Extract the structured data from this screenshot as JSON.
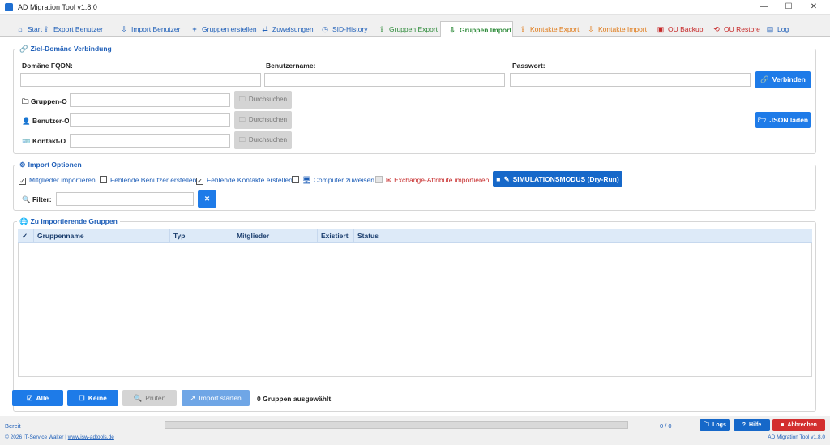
{
  "window": {
    "title": "AD Migration Tool v1.8.0",
    "minimize": "—",
    "maximize": "☐",
    "close": "✕"
  },
  "tabs": [
    {
      "label": "Start",
      "icon": "home-icon",
      "color": "#1f5fb8"
    },
    {
      "label": "Export Benutzer",
      "icon": "export-user-icon",
      "color": "#1f5fb8"
    },
    {
      "label": "Import Benutzer",
      "icon": "import-user-icon",
      "color": "#1f5fb8"
    },
    {
      "label": "Gruppen erstellen",
      "icon": "plus-icon",
      "color": "#1f5fb8"
    },
    {
      "label": "Zuweisungen",
      "icon": "assign-icon",
      "color": "#1f5fb8"
    },
    {
      "label": "SID-History",
      "icon": "history-icon",
      "color": "#1f5fb8"
    },
    {
      "label": "Gruppen Export",
      "icon": "group-export-icon",
      "color": "#2e8b3a"
    },
    {
      "label": "Gruppen Import",
      "icon": "group-import-icon",
      "color": "#2e8b3a"
    },
    {
      "label": "Kontakte Export",
      "icon": "contacts-export-icon",
      "color": "#e07b1a"
    },
    {
      "label": "Kontakte Import",
      "icon": "contacts-import-icon",
      "color": "#e07b1a"
    },
    {
      "label": "OU Backup",
      "icon": "backup-icon",
      "color": "#c62828"
    },
    {
      "label": "OU Restore",
      "icon": "restore-icon",
      "color": "#c62828"
    },
    {
      "label": "Log",
      "icon": "log-icon",
      "color": "#1f5fb8"
    }
  ],
  "connection": {
    "title": "Ziel-Domäne Verbindung",
    "fqdn_label": "Domäne FQDN:",
    "fqdn_value": "",
    "user_label": "Benutzername:",
    "user_value": "",
    "password_label": "Passwort:",
    "password_value": "",
    "connect_button": "Verbinden",
    "groups_ou_label": "Gruppen-O",
    "users_ou_label": "Benutzer-O",
    "contacts_ou_label": "Kontakt-O",
    "browse_label": "Durchsuchen",
    "json_button": "JSON laden"
  },
  "options": {
    "title": "Import Optionen",
    "items": [
      {
        "label": "Mitglieder importieren",
        "checked": true,
        "color": "#1f5fb8"
      },
      {
        "label": "Fehlende Benutzer erstellen",
        "checked": false,
        "color": "#1f5fb8"
      },
      {
        "label": "Fehlende Kontakte erstellen",
        "checked": true,
        "color": "#1f5fb8"
      },
      {
        "label": "Computer zuweisen",
        "checked": false,
        "color": "#1f5fb8"
      },
      {
        "label": "Exchange-Attribute importieren",
        "checked": false,
        "disabled": true,
        "color": "#c62828"
      }
    ],
    "simulation_button": "SIMULATIONSMODUS (Dry-Run)",
    "filter_label": "Filter:",
    "filter_value": "",
    "clear_filter": "✕"
  },
  "groups": {
    "title": "Zu importierende Gruppen",
    "columns": [
      "✓",
      "Gruppenname",
      "Typ",
      "Mitglieder",
      "Existiert",
      "Status"
    ],
    "rows": []
  },
  "actions": {
    "all_button": "Alle",
    "none_button": "Keine",
    "check_button": "Prüfen",
    "start_button": "Import starten",
    "selection_status": "0 Gruppen ausgewählt"
  },
  "status": {
    "state": "Bereit",
    "progress_fraction": 0,
    "counter": "0 / 0",
    "log_button": "Logs",
    "help_button": "Hilfe",
    "cancel_button": "Abbrechen",
    "copyright_prefix": "© 2026 IT-Service Walter | ",
    "website": "www.isw-adtools.de",
    "version": "AD Migration Tool v1.8.0"
  },
  "colors": {
    "accent": "#1e7be8",
    "danger": "#d32f2f",
    "header_bg": "#ddeaf8"
  }
}
